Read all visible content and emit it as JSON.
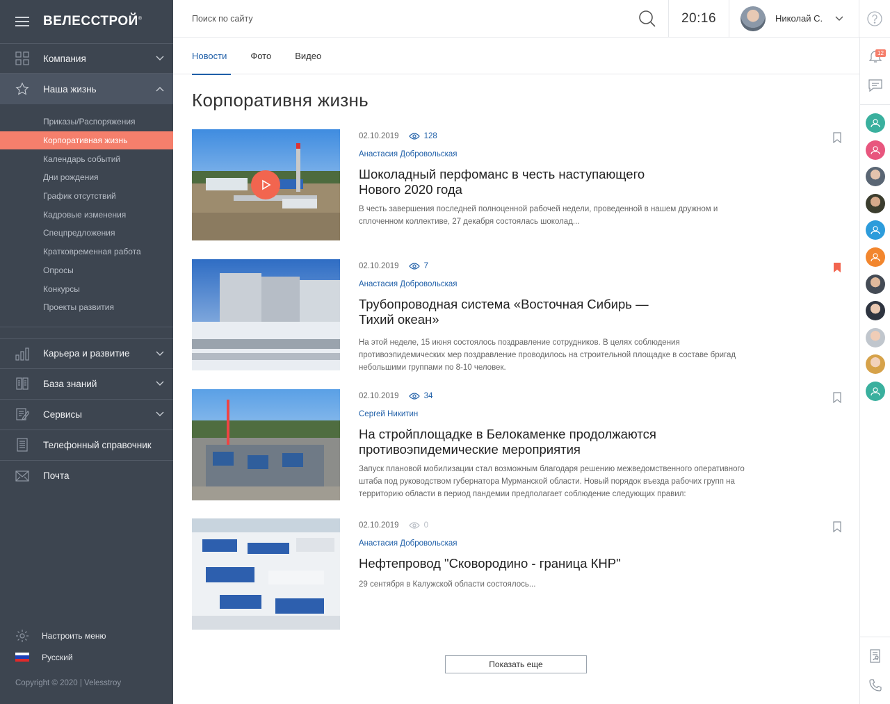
{
  "brand": {
    "logo_text": "ВЕЛЕССТРОЙ",
    "logo_mark": "®"
  },
  "header": {
    "search_placeholder": "Поиск по сайту",
    "time": "20:16",
    "user_name": "Николай С."
  },
  "sidebar": {
    "items": [
      {
        "label": "Компания",
        "icon": "grid-icon"
      },
      {
        "label": "Наша жизнь",
        "icon": "star-icon",
        "expanded": true
      }
    ],
    "subitems": [
      "Приказы/Распоряжения",
      "Корпоративная жизнь",
      "Календарь событий",
      "Дни рождения",
      "График отсутствий",
      "Кадровые изменения",
      "Спецпредложения",
      "Кратковременная работа",
      "Опросы",
      "Конкурсы",
      "Проекты развития"
    ],
    "active_subitem": "Корпоративная жизнь",
    "items_after": [
      {
        "label": "Карьера и развитие",
        "icon": "chart-icon"
      },
      {
        "label": "База знаний",
        "icon": "book-icon"
      },
      {
        "label": "Сервисы",
        "icon": "edit-icon"
      },
      {
        "label": "Телефонный справочник",
        "icon": "phonebook-icon"
      },
      {
        "label": "Почта",
        "icon": "mail-icon"
      }
    ],
    "settings_label": "Настроить меню",
    "language_label": "Русский",
    "copyright": "Copyright © 2020   |   Velesstroy"
  },
  "tabs": [
    {
      "label": "Новости",
      "active": true
    },
    {
      "label": "Фото",
      "active": false
    },
    {
      "label": "Видео",
      "active": false
    }
  ],
  "page_title": "Корпоративня жизнь",
  "news": [
    {
      "date": "02.10.2019",
      "views": "128",
      "author": "Анастасия Добровольская",
      "title_line1": "Шоколадный перфоманс в честь наступающего",
      "title_line2": "Нового 2020 года",
      "excerpt_line1": "В честь завершения последней полноценной рабочей недели, проведенной в нашем дружном и",
      "excerpt_line2": "сплоченном коллективе, 27 декабря  состоялась шоколад...",
      "excerpt_line3": "",
      "bookmarked": false,
      "video": true
    },
    {
      "date": "02.10.2019",
      "views": "7",
      "author": "Анастасия Добровольская",
      "title_line1": "Трубопроводная система «Восточная Сибирь —",
      "title_line2": "Тихий океан»",
      "excerpt_line1": "На этой неделе, 15 июня состоялось поздравление сотрудников. В целях соблюдения",
      "excerpt_line2": "противоэпидемических мер поздравление проводилось на строительной площадке в составе бригад",
      "excerpt_line3": "небольшими группами по 8-10 человек.",
      "bookmarked": true,
      "video": false
    },
    {
      "date": "02.10.2019",
      "views": "34",
      "author": "Сергей Никитин",
      "title_line1": "На стройплощадке в Белокаменке продолжаются",
      "title_line2": "противоэпидемические мероприятия",
      "excerpt_line1": "Запуск плановой мобилизации стал возможным благодаря решению межведомственного оперативного",
      "excerpt_line2": "штаба под руководством губернатора Мурманской области. Новый порядок въезда рабочих групп на",
      "excerpt_line3": "территорию области в период пандемии предполагает соблюдение следующих правил:",
      "bookmarked": false,
      "video": false
    },
    {
      "date": "02.10.2019",
      "views": "0",
      "author": "Анастасия Добровольская",
      "title_line1": "Нефтепровод \"Сковородино - граница КНР\"",
      "title_line2": "",
      "excerpt_line1": "29 сентября в Калужской области состоялось...",
      "excerpt_line2": "",
      "excerpt_line3": "",
      "bookmarked": false,
      "video": false
    }
  ],
  "show_more_label": "Показать еще",
  "rail": {
    "notifications_count": "12",
    "user_avatars": [
      "teal",
      "pink",
      "photo",
      "photo",
      "blue",
      "orange",
      "photo",
      "photo",
      "photo",
      "photo",
      "teal"
    ]
  },
  "colors": {
    "sidebar_bg": "#3d4550",
    "accent": "#f57f6c",
    "link": "#1f5fa8"
  }
}
